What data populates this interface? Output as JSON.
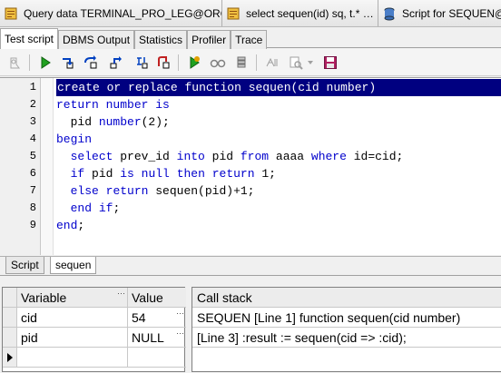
{
  "doc_tabs": [
    {
      "label": "Query data TERMINAL_PRO_LEG@ORCL",
      "icon": "query-window-icon"
    },
    {
      "label": "select sequen(id) sq, t.* …",
      "icon": "query-window-icon"
    },
    {
      "label": "Script for SEQUEN@ORCL",
      "icon": "db-script-icon"
    }
  ],
  "panel_tabs": [
    "Test script",
    "DBMS Output",
    "Statistics",
    "Profiler",
    "Trace"
  ],
  "toolbar": {
    "icons": [
      "debug-ghost-icon",
      "run-icon",
      "step-into-icon",
      "step-over-icon",
      "step-out-icon",
      "run-to-exception-icon",
      "run-to-end-icon",
      "toggle-breakpoint-icon",
      "watch-icon",
      "stack-icon",
      "jump-icon",
      "find-icon",
      "dropdown-arrow-icon",
      "save-icon"
    ]
  },
  "editor": {
    "line_numbers": [
      "1",
      "2",
      "3",
      "4",
      "5",
      "6",
      "7",
      "8",
      "9"
    ],
    "lines": [
      [
        {
          "t": "create",
          "kw": true
        },
        {
          "t": " "
        },
        {
          "t": "or",
          "kw": true
        },
        {
          "t": " "
        },
        {
          "t": "replace",
          "kw": true
        },
        {
          "t": " "
        },
        {
          "t": "function",
          "kw": true
        },
        {
          "t": " sequen(cid "
        },
        {
          "t": "number",
          "kw": true
        },
        {
          "t": ")"
        }
      ],
      [
        {
          "t": "return",
          "kw": true
        },
        {
          "t": " "
        },
        {
          "t": "number",
          "kw": true
        },
        {
          "t": " "
        },
        {
          "t": "is",
          "kw": true
        }
      ],
      [
        {
          "t": "  pid "
        },
        {
          "t": "number",
          "kw": true
        },
        {
          "t": "(2);"
        }
      ],
      [
        {
          "t": "begin",
          "kw": true
        }
      ],
      [
        {
          "t": "  "
        },
        {
          "t": "select",
          "kw": true
        },
        {
          "t": " prev_id "
        },
        {
          "t": "into",
          "kw": true
        },
        {
          "t": " pid "
        },
        {
          "t": "from",
          "kw": true
        },
        {
          "t": " aaaa "
        },
        {
          "t": "where",
          "kw": true
        },
        {
          "t": " id=cid;"
        }
      ],
      [
        {
          "t": "  "
        },
        {
          "t": "if",
          "kw": true
        },
        {
          "t": " pid "
        },
        {
          "t": "is",
          "kw": true
        },
        {
          "t": " "
        },
        {
          "t": "null",
          "kw": true
        },
        {
          "t": " "
        },
        {
          "t": "then",
          "kw": true
        },
        {
          "t": " "
        },
        {
          "t": "return",
          "kw": true
        },
        {
          "t": " 1;"
        }
      ],
      [
        {
          "t": "  "
        },
        {
          "t": "else",
          "kw": true
        },
        {
          "t": " "
        },
        {
          "t": "return",
          "kw": true
        },
        {
          "t": " sequen(pid)+1;"
        }
      ],
      [
        {
          "t": "  "
        },
        {
          "t": "end",
          "kw": true
        },
        {
          "t": " "
        },
        {
          "t": "if",
          "kw": true
        },
        {
          "t": ";"
        }
      ],
      [
        {
          "t": "end",
          "kw": true
        },
        {
          "t": ";"
        }
      ]
    ],
    "highlighted_line": 1,
    "keyword_color": "#0000cc",
    "highlight_color": "#000080"
  },
  "editor_tabs": [
    "Script",
    "sequen"
  ],
  "variables": {
    "headers": [
      "Variable",
      "Value"
    ],
    "rows": [
      {
        "name": "cid",
        "value": "54"
      },
      {
        "name": "pid",
        "value": "NULL"
      }
    ],
    "ellipsis": "···"
  },
  "call_stack": {
    "header": "Call stack",
    "rows": [
      "SEQUEN [Line 1] function sequen(cid number)",
      "[Line 3]   :result := sequen(cid => :cid);"
    ]
  }
}
